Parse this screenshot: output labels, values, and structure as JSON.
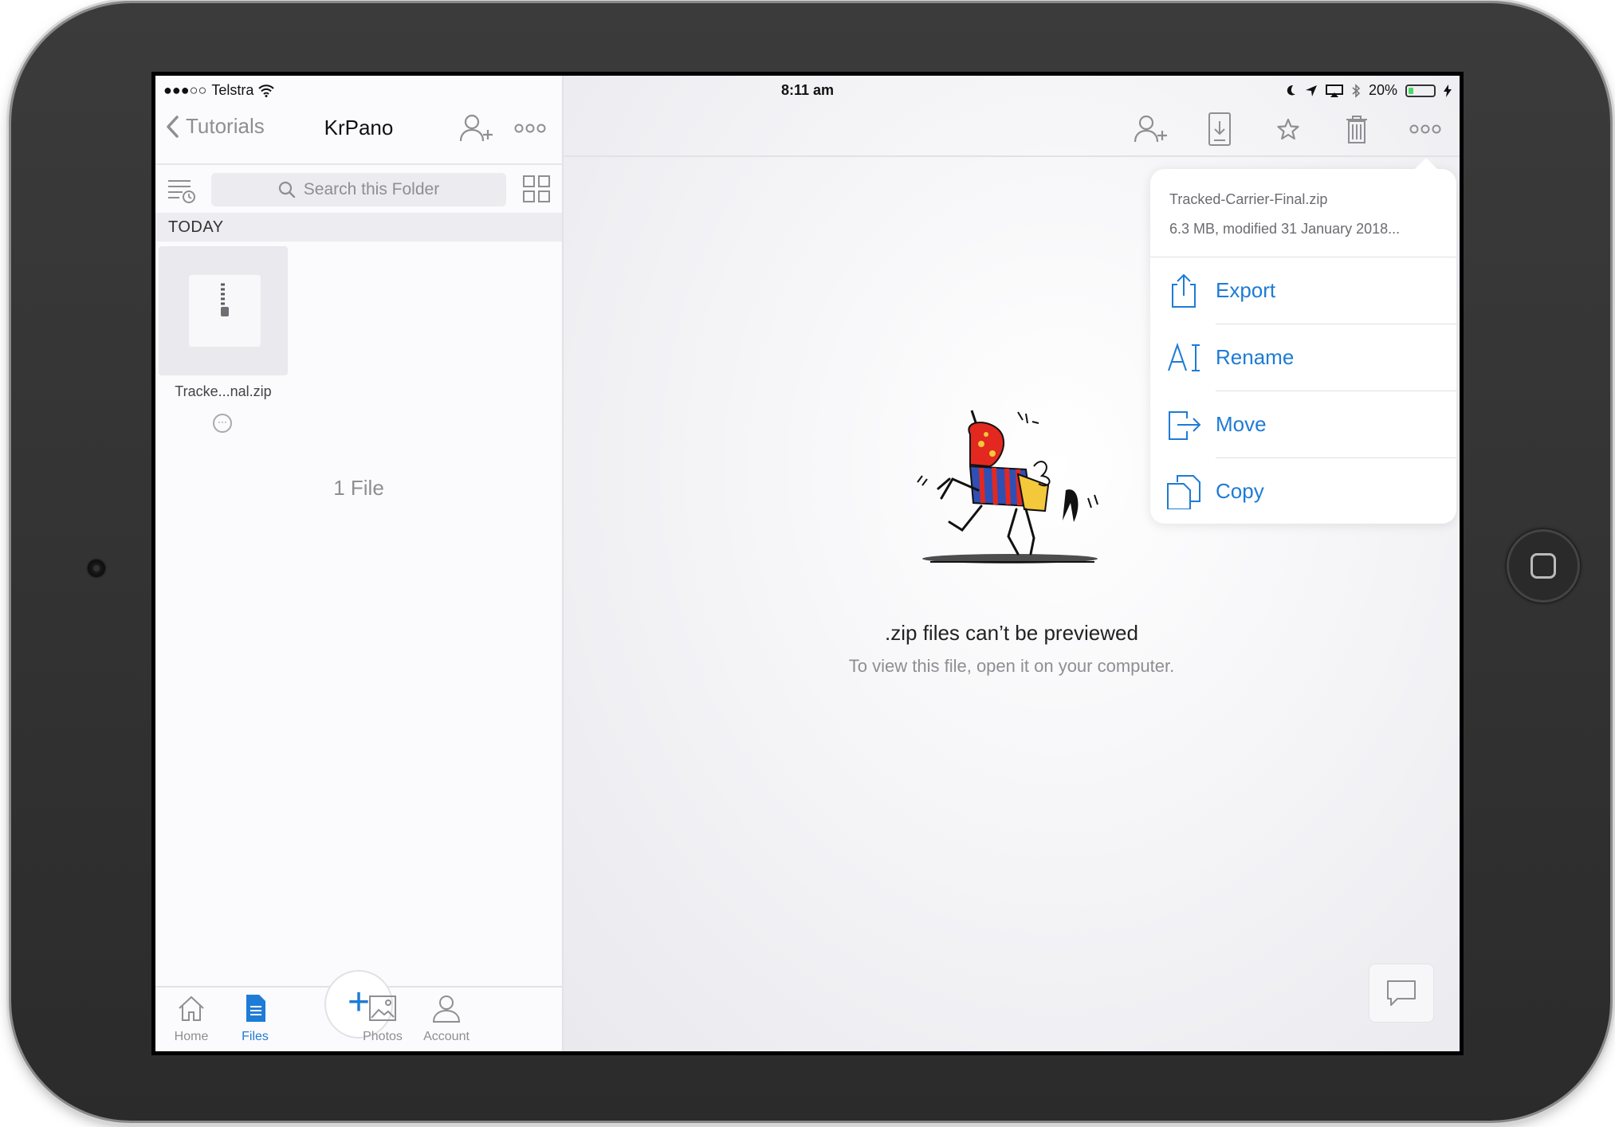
{
  "status": {
    "signal_dots": "●●●○○",
    "carrier": "Telstra",
    "time": "8:11 am",
    "battery": "20%",
    "battery_level": 0.2
  },
  "nav": {
    "back_label": "Tutorials",
    "title": "KrPano"
  },
  "search": {
    "placeholder": "Search this Folder"
  },
  "section_header": "TODAY",
  "file": {
    "name": "Tracke...nal.zip",
    "more": "···"
  },
  "file_count": "1 File",
  "tabs": {
    "home": "Home",
    "files": "Files",
    "plus": "+",
    "photos": "Photos",
    "account": "Account"
  },
  "preview": {
    "title": ".zip files can’t be previewed",
    "subtitle": "To view this file, open it on your computer."
  },
  "popover": {
    "filename": "Tracked-Carrier-Final.zip",
    "meta": "6.3 MB, modified 31 January 2018...",
    "items": [
      {
        "label": "Export",
        "icon": "export-icon"
      },
      {
        "label": "Rename",
        "icon": "rename-icon"
      },
      {
        "label": "Move",
        "icon": "move-icon"
      },
      {
        "label": "Copy",
        "icon": "copy-icon"
      }
    ]
  },
  "colors": {
    "accent": "#1e7bd6",
    "secondary_text": "#8e8e93",
    "battery_green": "#4cd964"
  }
}
